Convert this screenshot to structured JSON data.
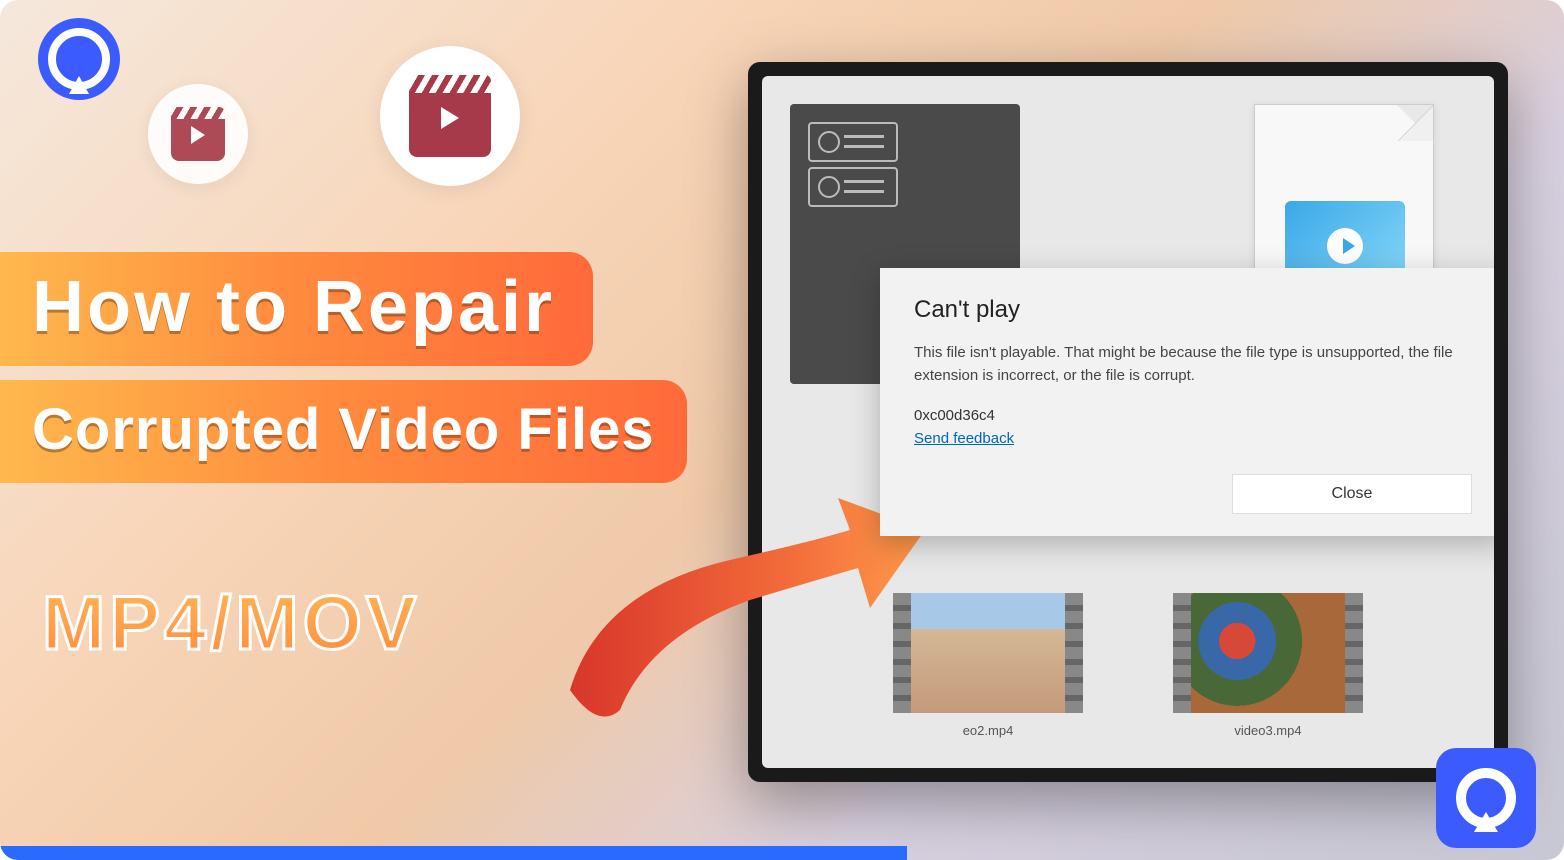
{
  "title_line1": "How to Repair",
  "title_line2": "Corrupted Video Files",
  "subtitle": "MP4/MOV",
  "dialog": {
    "heading": "Can't play",
    "body": "This file isn't playable. That might be because the file type is unsupported, the file extension is incorrect, or the file is corrupt.",
    "error_code": "0xc00d36c4",
    "feedback_link": "Send feedback",
    "close_label": "Close"
  },
  "thumbs": {
    "file2": "eo2.mp4",
    "file3": "video3.mp4"
  }
}
